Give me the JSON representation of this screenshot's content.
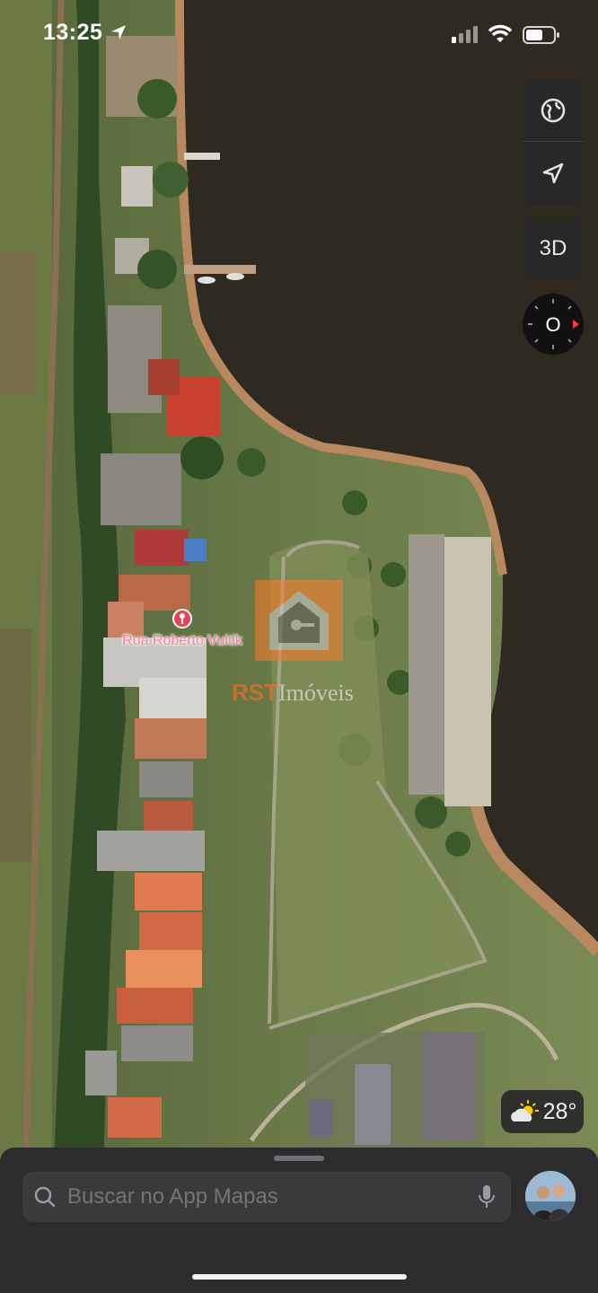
{
  "status_bar": {
    "time": "13:25"
  },
  "map": {
    "place_label": "Rua Roberto Vuitik",
    "watermark": {
      "brand": "RST",
      "text": "Imóveis"
    }
  },
  "controls": {
    "three_d_label": "3D",
    "compass_label": "O"
  },
  "weather": {
    "temperature": "28°",
    "icon": "partly-sunny-icon"
  },
  "search": {
    "placeholder": "Buscar no App Mapas"
  },
  "colors": {
    "water": "#2e2a22",
    "accent_pin": "#e8425a",
    "sheet_bg": "#2c2c2e"
  }
}
